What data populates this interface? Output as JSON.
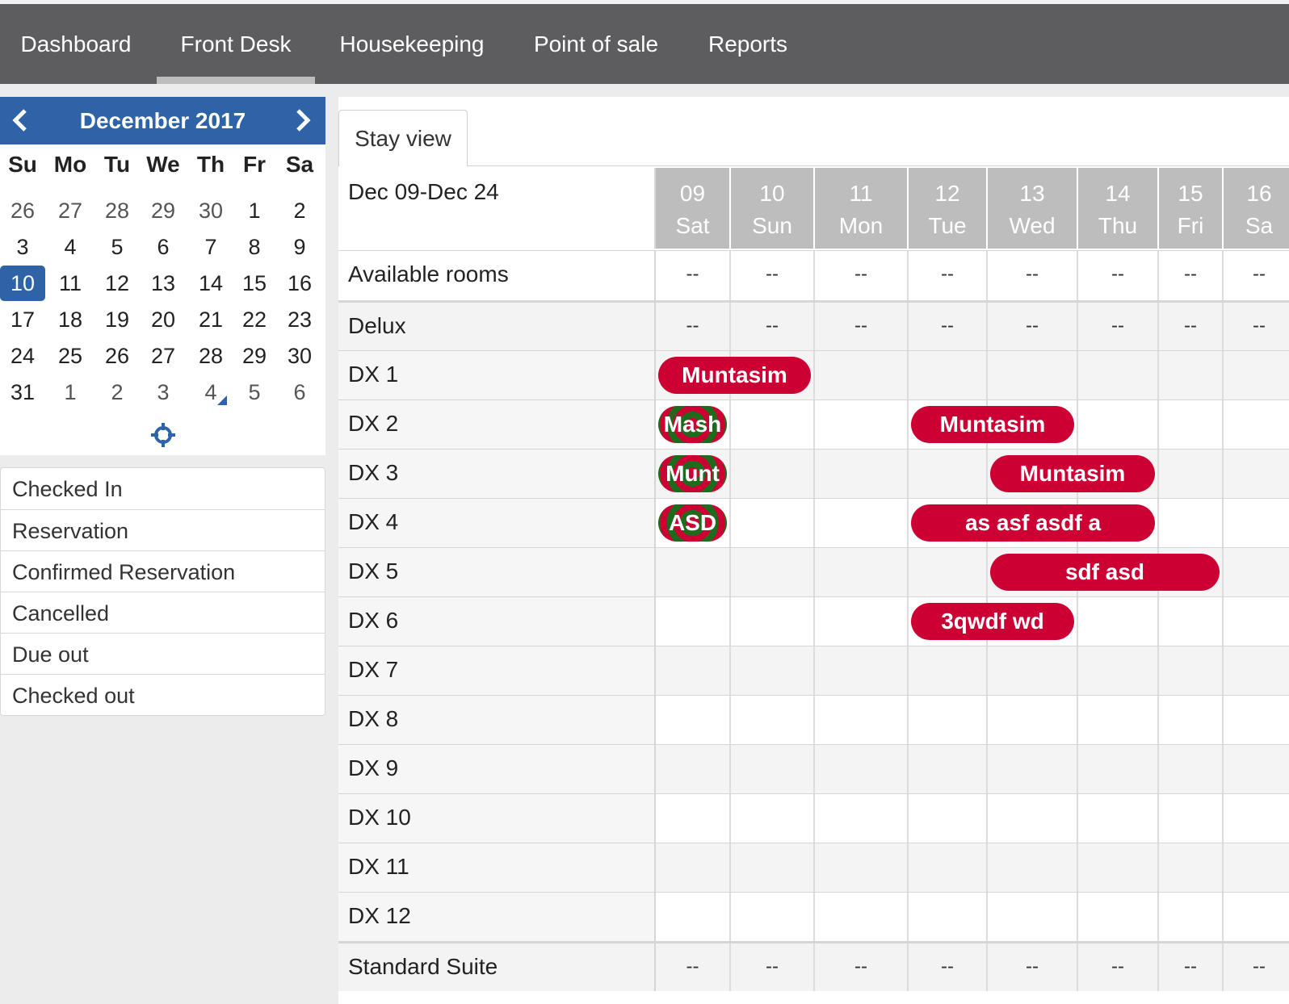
{
  "nav": {
    "items": [
      "Dashboard",
      "Front Desk",
      "Housekeeping",
      "Point of sale",
      "Reports"
    ],
    "active": "Front Desk"
  },
  "calendar": {
    "month_label": "December 2017",
    "prev_icon": "chevron-left-icon",
    "next_icon": "chevron-right-icon",
    "weekdays": [
      "Su",
      "Mo",
      "Tu",
      "We",
      "Th",
      "Fr",
      "Sa"
    ],
    "weeks": [
      [
        "26",
        "27",
        "28",
        "29",
        "30",
        "1",
        "2"
      ],
      [
        "3",
        "4",
        "5",
        "6",
        "7",
        "8",
        "9"
      ],
      [
        "10",
        "11",
        "12",
        "13",
        "14",
        "15",
        "16"
      ],
      [
        "17",
        "18",
        "19",
        "20",
        "21",
        "22",
        "23"
      ],
      [
        "24",
        "25",
        "26",
        "27",
        "28",
        "29",
        "30"
      ],
      [
        "31",
        "1",
        "2",
        "3",
        "4",
        "5",
        "6"
      ]
    ],
    "selected_day": "10",
    "today_icon": "crosshair-icon",
    "accent": "#2e63a8"
  },
  "legend": [
    "Checked In",
    "Reservation",
    "Confirmed Reservation",
    "Cancelled",
    "Due out",
    "Checked out"
  ],
  "stay_view": {
    "tab_label": "Stay view",
    "range_label": "Dec 09-Dec 24",
    "days": [
      {
        "num": "09",
        "dow": "Sat"
      },
      {
        "num": "10",
        "dow": "Sun"
      },
      {
        "num": "11",
        "dow": "Mon"
      },
      {
        "num": "12",
        "dow": "Tue"
      },
      {
        "num": "13",
        "dow": "Wed"
      },
      {
        "num": "14",
        "dow": "Thu"
      },
      {
        "num": "15",
        "dow": "Fri"
      },
      {
        "num": "16",
        "dow": "Sa"
      }
    ],
    "empty_mark": "--",
    "rows": [
      {
        "label": "Available rooms",
        "type": "summary"
      },
      {
        "label": "Delux",
        "type": "category"
      },
      {
        "label": "DX 1",
        "type": "room"
      },
      {
        "label": "DX 2",
        "type": "room"
      },
      {
        "label": "DX 3",
        "type": "room"
      },
      {
        "label": "DX 4",
        "type": "room"
      },
      {
        "label": "DX 5",
        "type": "room"
      },
      {
        "label": "DX 6",
        "type": "room"
      },
      {
        "label": "DX 7",
        "type": "room"
      },
      {
        "label": "DX 8",
        "type": "room"
      },
      {
        "label": "DX 9",
        "type": "room"
      },
      {
        "label": "DX 10",
        "type": "room"
      },
      {
        "label": "DX 11",
        "type": "room"
      },
      {
        "label": "DX 12",
        "type": "room"
      },
      {
        "label": "Standard Suite",
        "type": "category"
      }
    ],
    "bookings": [
      {
        "room": "DX 1",
        "name": "Muntasim",
        "start": "09",
        "end": "10",
        "status": "reservation"
      },
      {
        "room": "DX 2",
        "name": "Mash",
        "start": "09",
        "end": "09",
        "status": "checked-in"
      },
      {
        "room": "DX 2",
        "name": "Muntasim",
        "start": "12",
        "end": "13",
        "status": "reservation"
      },
      {
        "room": "DX 3",
        "name": "Munt",
        "start": "09",
        "end": "09",
        "status": "checked-in"
      },
      {
        "room": "DX 3",
        "name": "Muntasim",
        "start": "13",
        "end": "14",
        "status": "reservation"
      },
      {
        "room": "DX 4",
        "name": "ASD",
        "start": "09",
        "end": "09",
        "status": "checked-in"
      },
      {
        "room": "DX 4",
        "name": "as asf asdf a",
        "start": "12",
        "end": "14",
        "status": "reservation"
      },
      {
        "room": "DX 5",
        "name": "sdf asd",
        "start": "13",
        "end": "15",
        "status": "reservation"
      },
      {
        "room": "DX 6",
        "name": "3qwdf wd",
        "start": "12",
        "end": "13",
        "status": "reservation"
      }
    ],
    "booking_color": "#cc0033",
    "checked_in_color": "#1e6b1e"
  }
}
